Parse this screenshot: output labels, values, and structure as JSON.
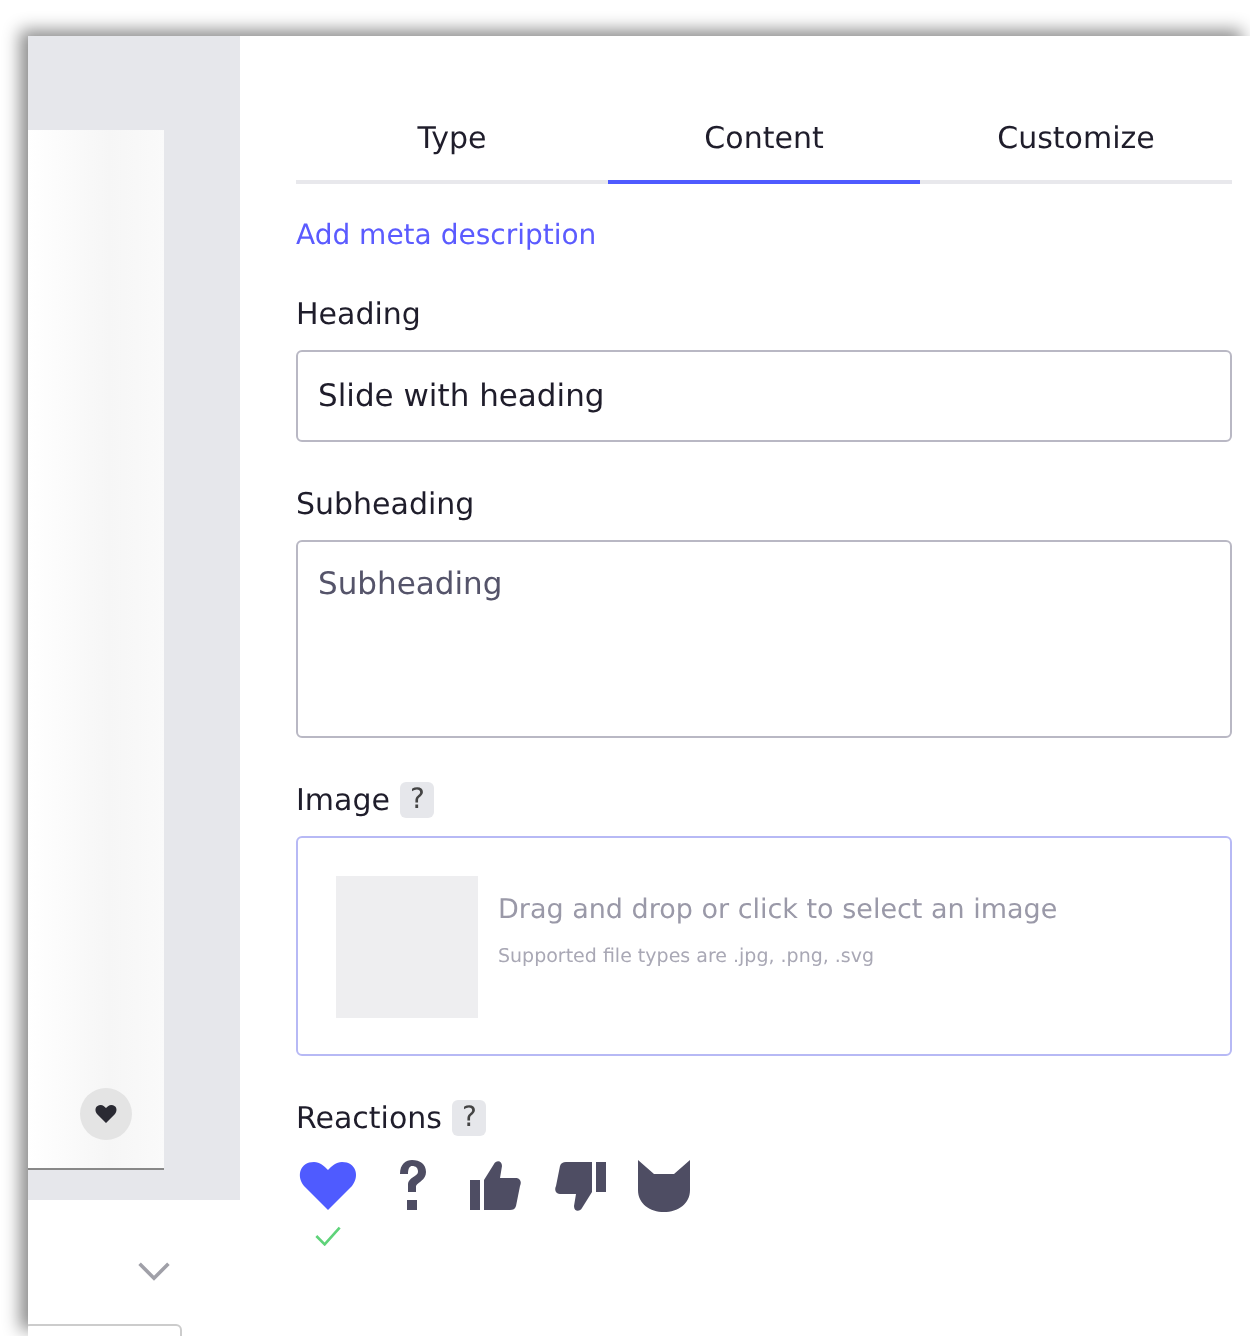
{
  "tabs": [
    {
      "label": "Type",
      "selected": false
    },
    {
      "label": "Content",
      "selected": true
    },
    {
      "label": "Customize",
      "selected": false
    }
  ],
  "meta_link": "Add meta description",
  "heading": {
    "label": "Heading",
    "value": "Slide with heading"
  },
  "subheading": {
    "label": "Subheading",
    "placeholder": "Subheading"
  },
  "image": {
    "label": "Image",
    "help": "?",
    "prompt": "Drag and drop or click to select an image",
    "hint": "Supported file types are .jpg, .png, .svg"
  },
  "reactions": {
    "label": "Reactions",
    "help": "?",
    "items": [
      {
        "kind": "heart",
        "selected": true
      },
      {
        "kind": "question",
        "selected": false
      },
      {
        "kind": "thumbs-up",
        "selected": false
      },
      {
        "kind": "thumbs-down",
        "selected": false
      },
      {
        "kind": "cat",
        "selected": false
      }
    ]
  }
}
